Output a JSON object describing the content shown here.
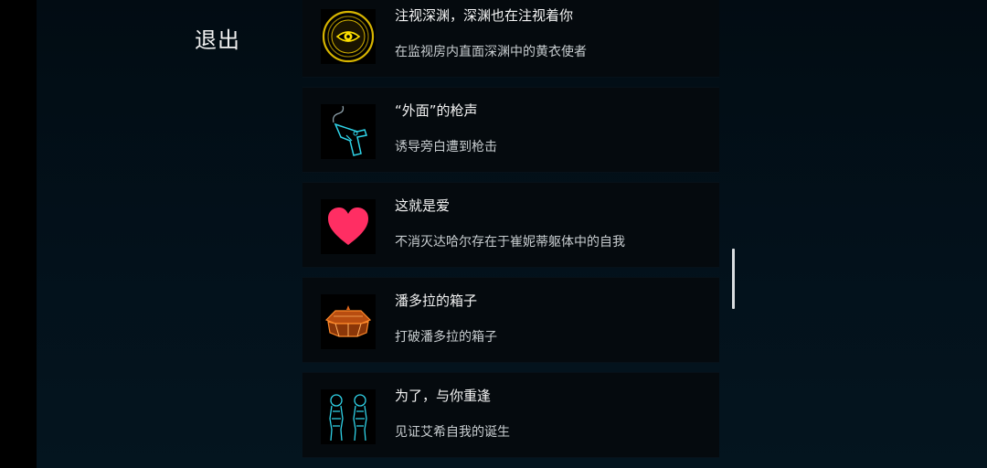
{
  "nav": {
    "exit_label": "退出"
  },
  "achievements": [
    {
      "title": "注视深渊，深渊也在注视着你",
      "description": "在监视房内直面深渊中的黄衣使者",
      "icon": "eye-icon"
    },
    {
      "title": "“外面”的枪声",
      "description": "诱导旁白遭到枪击",
      "icon": "pistol-icon"
    },
    {
      "title": "这就是爱",
      "description": "不消灭达哈尔存在于崔妮蒂躯体中的自我",
      "icon": "heart-icon"
    },
    {
      "title": "潘多拉的箱子",
      "description": "打破潘多拉的箱子",
      "icon": "pandora-box-icon"
    },
    {
      "title": "为了，与你重逢",
      "description": "见证艾希自我的诞生",
      "icon": "twin-figures-icon"
    }
  ],
  "colors": {
    "background": "#03111b",
    "card": "#050a0e",
    "heart": "#ff2e63",
    "gold": "#d6b400",
    "cyan": "#2fd3e8",
    "orange": "#e0661a"
  }
}
